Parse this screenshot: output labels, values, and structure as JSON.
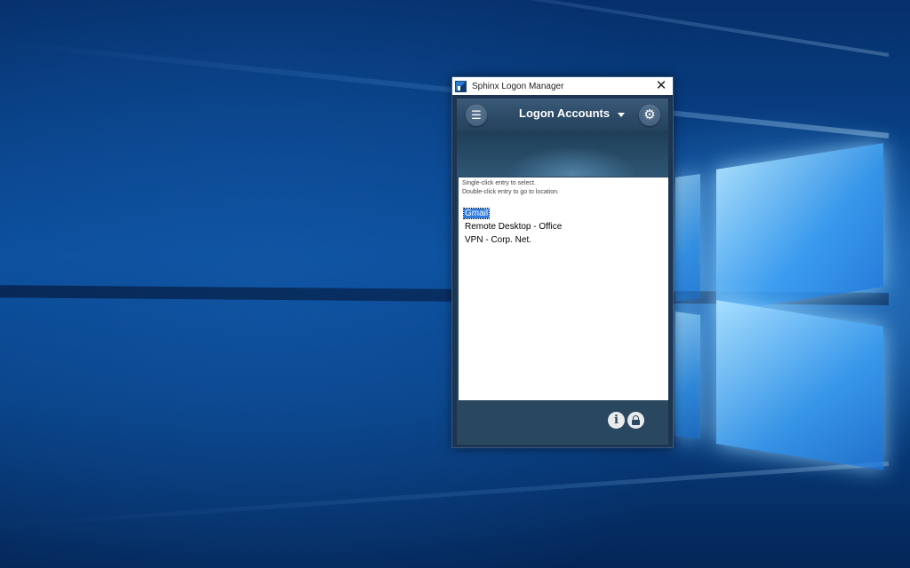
{
  "window": {
    "title": "Sphinx Logon Manager",
    "close_glyph": "✕"
  },
  "header": {
    "title": "Logon Accounts",
    "menu_glyph": "☰",
    "settings_glyph": "⚙"
  },
  "instructions": {
    "line1": "Single-click entry to select.",
    "line2": "Double-click entry to go to location."
  },
  "entries": [
    {
      "label": "Gmail",
      "selected": true
    },
    {
      "label": "Remote Desktop - Office",
      "selected": false
    },
    {
      "label": "VPN - Corp. Net.",
      "selected": false
    }
  ],
  "footer": {
    "info_glyph": "i",
    "icons": [
      "info-icon",
      "lock-icon"
    ]
  },
  "colors": {
    "panel": "#2a4760",
    "selection": "#2f7de1",
    "desktop": "#0a4d9a"
  }
}
